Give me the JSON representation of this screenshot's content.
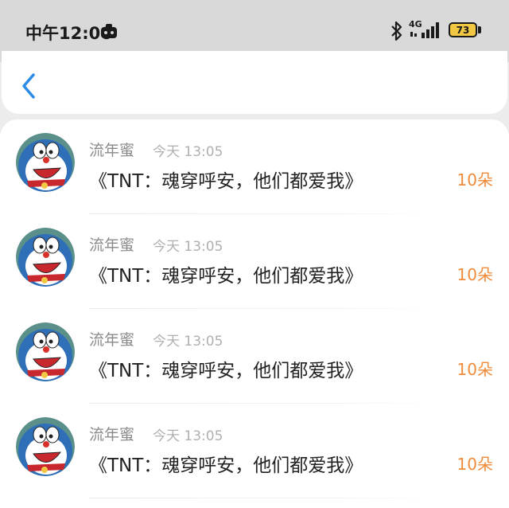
{
  "status_bar": {
    "time": "中午12:06",
    "network_type": "4G",
    "battery_level": "73",
    "app_icon": "game-controller-icon",
    "bluetooth_icon": "bluetooth-icon",
    "signal_icon": "cellular-signal-icon"
  },
  "header": {
    "back_icon": "chevron-left-icon",
    "accent_color": "#2b8be6"
  },
  "items": [
    {
      "name": "流年蜜",
      "time": "今天 13:05",
      "title": "《TNT：魂穿呼安，他们都爱我》",
      "amount": "10朵"
    },
    {
      "name": "流年蜜",
      "time": "今天 13:05",
      "title": "《TNT：魂穿呼安，他们都爱我》",
      "amount": "10朵"
    },
    {
      "name": "流年蜜",
      "time": "今天 13:05",
      "title": "《TNT：魂穿呼安，他们都爱我》",
      "amount": "10朵"
    },
    {
      "name": "流年蜜",
      "time": "今天 13:05",
      "title": "《TNT：魂穿呼安，他们都爱我》",
      "amount": "10朵"
    }
  ],
  "colors": {
    "amount": "#f08b3a",
    "name": "#8a8a8a",
    "time": "#b0b0b0",
    "title": "#222222"
  }
}
